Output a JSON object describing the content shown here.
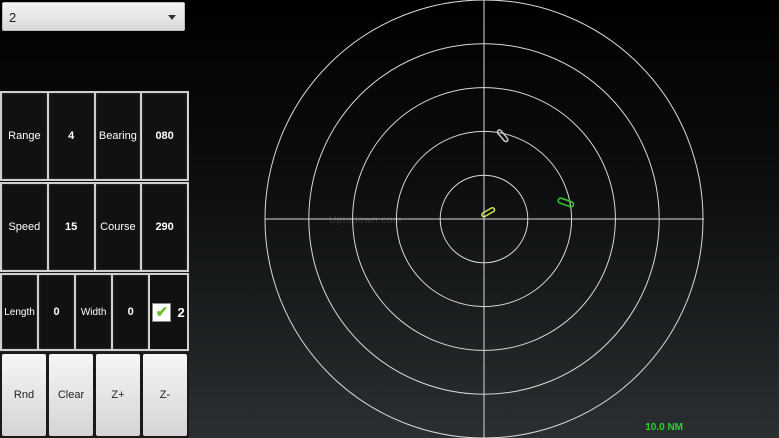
{
  "selector": {
    "value": "2"
  },
  "row1": {
    "range_label": "Range",
    "range_value": "4",
    "bearing_label": "Bearing",
    "bearing_value": "080"
  },
  "row2": {
    "speed_label": "Speed",
    "speed_value": "15",
    "course_label": "Course",
    "course_value": "290"
  },
  "row3": {
    "length_label": "Length",
    "length_value": "0",
    "width_label": "Width",
    "width_value": "0",
    "checkbox_label": "2",
    "checked": true
  },
  "buttons": {
    "rnd": "Rnd",
    "clear": "Clear",
    "zoom_in": "Z+",
    "zoom_out": "Z-"
  },
  "radar": {
    "range_label": "10.0 NM",
    "watermark": "Uptodown.com",
    "ring_count": 5,
    "colors": {
      "rings": "#d8d8d8",
      "own_ship": "#d7e65a",
      "target_green": "#2fd12f",
      "target_gray": "#c8c8c8"
    }
  }
}
